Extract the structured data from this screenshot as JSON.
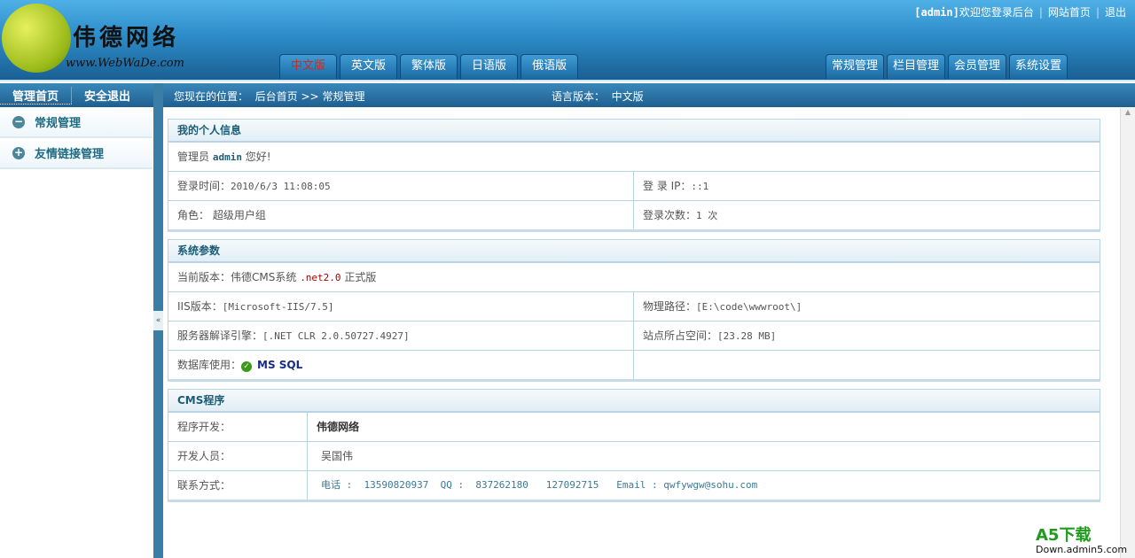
{
  "header": {
    "logo_cn": "伟德网络",
    "logo_url": "www.WebWaDe.com",
    "user": "[admin]",
    "welcome": "欢迎您登录后台",
    "site_home": "网站首页",
    "logout": "退出",
    "lang_tabs": [
      "中文版",
      "英文版",
      "繁体版",
      "日语版",
      "俄语版"
    ],
    "main_tabs": [
      "常规管理",
      "栏目管理",
      "会员管理",
      "系统设置"
    ]
  },
  "nav": {
    "home": "管理首页",
    "exit": "安全退出",
    "location_label": "您现在的位置：",
    "crumb_home": "后台首页",
    "crumb_sep": ">>",
    "crumb_current": "常规管理",
    "lang_label": "语言版本：",
    "lang_value": "中文版"
  },
  "sidebar": {
    "items": [
      {
        "label": "常规管理",
        "icon": "minus-circle-icon"
      },
      {
        "label": "友情链接管理",
        "icon": "plus-circle-icon"
      }
    ],
    "collapse": "«"
  },
  "personal": {
    "title": "我的个人信息",
    "greet_prefix": "管理员",
    "user": "admin",
    "greet_suffix": "您好!",
    "login_time_label": "登录时间：",
    "login_time": "2010/6/3 11:08:05",
    "ip_label": "登 录 IP：",
    "ip": "::1",
    "role_label": "角色：",
    "role": "超级用户组",
    "count_label": "登录次数：",
    "count": "1 次"
  },
  "system": {
    "title": "系统参数",
    "version_label": "当前版本：伟德CMS系统",
    "version_net": ".net2.0",
    "version_suffix": "正式版",
    "iis_label": "IIS版本：",
    "iis": "[Microsoft-IIS/7.5]",
    "path_label": "物理路径：",
    "path": "[E:\\code\\wwwroot\\]",
    "engine_label": "服务器解译引擎：",
    "engine": "[.NET CLR 2.0.50727.4927]",
    "space_label": "站点所占空间：",
    "space": "[23.28 MB]",
    "db_label": "数据库使用：",
    "db": "MS SQL"
  },
  "cms": {
    "title": "CMS程序",
    "dev_label": "程序开发：",
    "dev": "伟德网络",
    "people_label": "开发人员：",
    "people": "吴国伟",
    "contact_label": "联系方式：",
    "contact": "电话 :  13590820937  QQ :  837262180   127092715   Email : qwfywgw@sohu.com"
  },
  "watermark": {
    "brand": "A5下载",
    "url": "Down.admin5.com"
  }
}
